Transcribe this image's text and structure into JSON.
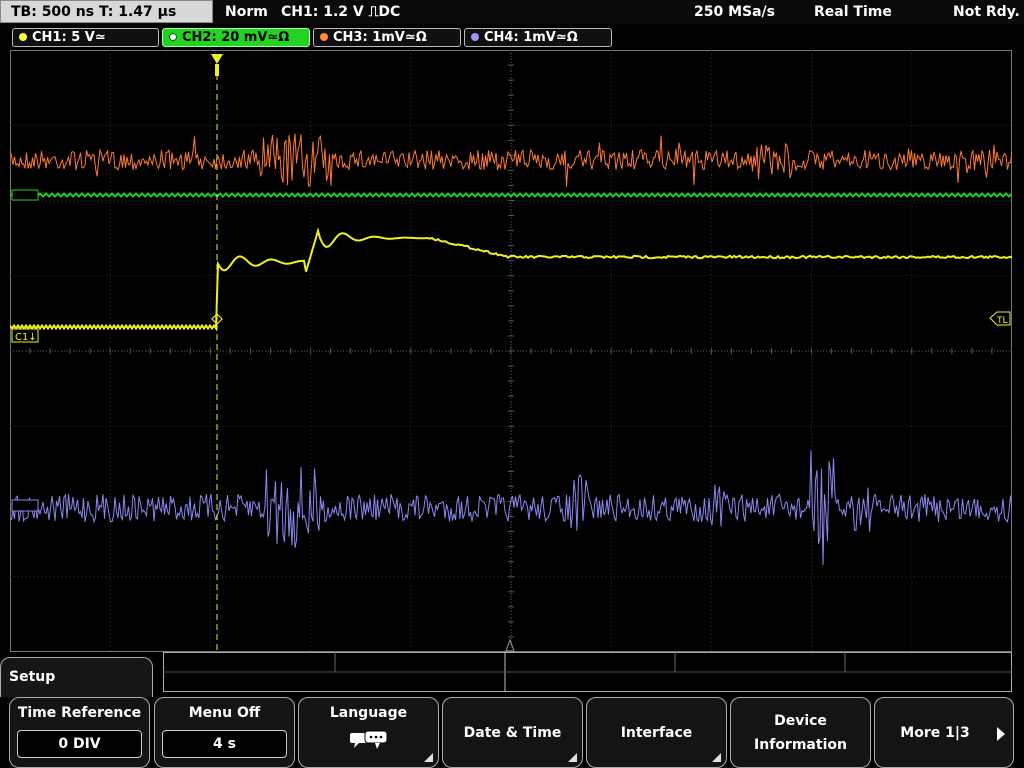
{
  "status_bar": {
    "timebase": "TB: 500 ns   T: 1.47 µs",
    "mode": "Norm",
    "trigger": "CH1: 1.2 V ⎍DC",
    "sample_rate": "250 MSa/s",
    "acq_mode": "Real Time",
    "state": "Not Rdy."
  },
  "channels": [
    {
      "label": "CH1: 5 V≃",
      "color": "#ffff40",
      "active": false
    },
    {
      "label": "CH2: 20 mV≃Ω",
      "color": "#22d322",
      "active": true
    },
    {
      "label": "CH3: 1mV≃Ω",
      "color": "#ff8a3a",
      "active": false
    },
    {
      "label": "CH4: 1mV≃Ω",
      "color": "#9a9aff",
      "active": false
    }
  ],
  "markers": {
    "trigger_level": "TL",
    "ch1_ref": "C1↓"
  },
  "traces": {
    "ch1_color": "#f0f020",
    "ch2_color": "#22cc22",
    "ch3_color": "#ff7a30",
    "ch4_color": "#8888ee"
  },
  "menu": {
    "title": "Setup",
    "softkeys": [
      {
        "title": "Time Reference",
        "value": "0 DIV"
      },
      {
        "title": "Menu Off",
        "value": "4 s"
      },
      {
        "title": "Language",
        "icon": "speech-bubble-icon"
      },
      {
        "title": "Date & Time"
      },
      {
        "title": "Interface"
      },
      {
        "title": "Device\nInformation",
        "line1": "Device",
        "line2": "Information"
      },
      {
        "title": "More 1|3"
      }
    ]
  }
}
